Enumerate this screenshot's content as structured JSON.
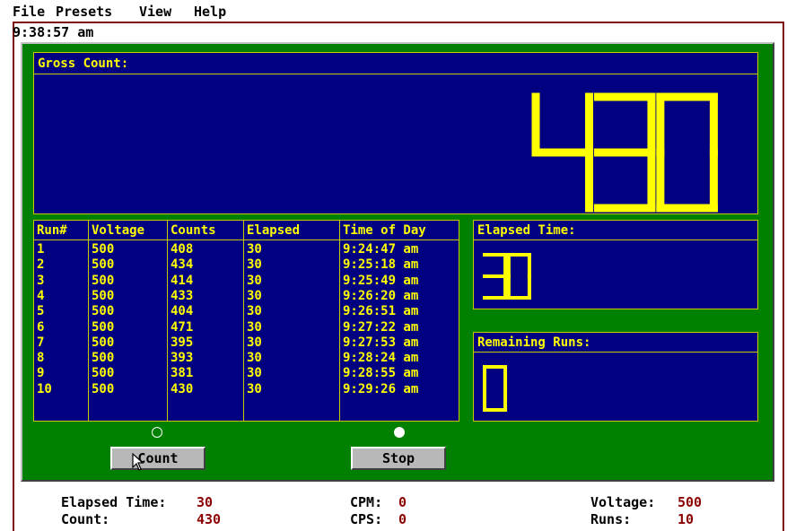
{
  "menu": [
    "File",
    "Presets",
    "View",
    "Help"
  ],
  "clock": "9:38:57 am",
  "gross": {
    "label": "Gross Count:",
    "value": "430"
  },
  "table": {
    "headers": [
      "Run#",
      "Voltage",
      "Counts",
      "Elapsed",
      "Time of Day"
    ],
    "rows": [
      [
        "1",
        "500",
        "408",
        "30",
        "9:24:47 am"
      ],
      [
        "2",
        "500",
        "434",
        "30",
        "9:25:18 am"
      ],
      [
        "3",
        "500",
        "414",
        "30",
        "9:25:49 am"
      ],
      [
        "4",
        "500",
        "433",
        "30",
        "9:26:20 am"
      ],
      [
        "5",
        "500",
        "404",
        "30",
        "9:26:51 am"
      ],
      [
        "6",
        "500",
        "471",
        "30",
        "9:27:22 am"
      ],
      [
        "7",
        "500",
        "395",
        "30",
        "9:27:53 am"
      ],
      [
        "8",
        "500",
        "393",
        "30",
        "9:28:24 am"
      ],
      [
        "9",
        "500",
        "381",
        "30",
        "9:28:55 am"
      ],
      [
        "10",
        "500",
        "430",
        "30",
        "9:29:26 am"
      ]
    ]
  },
  "elapsed_box": {
    "label": "Elapsed Time:",
    "value": "30"
  },
  "remaining_box": {
    "label": "Remaining Runs:",
    "value": "0"
  },
  "buttons": {
    "count": "Count",
    "stop": "Stop"
  },
  "indicators": {
    "count_selected": false,
    "stop_selected": true
  },
  "status": {
    "elapsed_label": "Elapsed Time:",
    "elapsed": "30",
    "count_label": "Count:",
    "count": "430",
    "cpm_label": "CPM:",
    "cpm": "0",
    "cps_label": "CPS:",
    "cps": "0",
    "voltage_label": "Voltage:",
    "voltage": "500",
    "runs_label": "Runs:",
    "runs": "10"
  },
  "colors": {
    "panel": "#008000",
    "display_bg": "#000080",
    "digit": "#ffff00",
    "value_text": "#8b0000"
  }
}
